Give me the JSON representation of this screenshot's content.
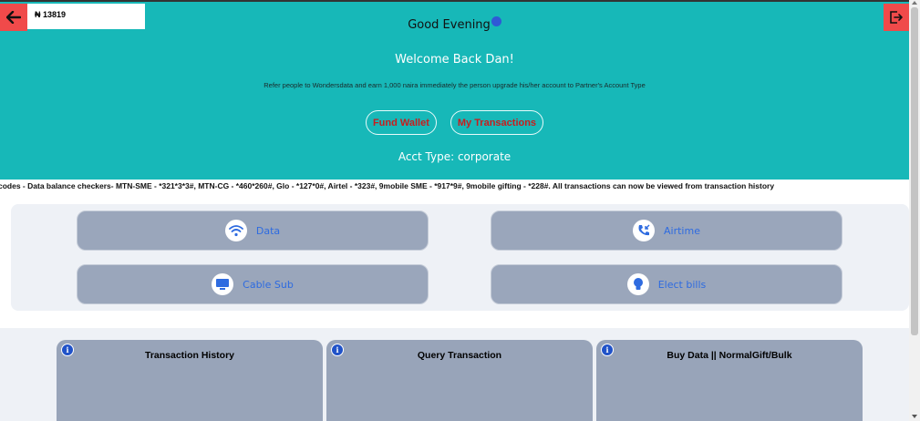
{
  "header": {
    "balance": "₦ 13819",
    "greeting": "Good Evening",
    "welcome": "Welcome Back Dan!",
    "refer_text": "Refer people to Wondersdata and earn 1,000 naira immediately the person upgrade his/her account to Partner's Account Type",
    "fund_wallet_label": "Fund Wallet",
    "my_transactions_label": "My Transactions",
    "account_type": "Acct Type: corporate"
  },
  "marquee": {
    "text": "codes - Data balance checkers- MTN-SME - *321*3*3#, MTN-CG - *460*260#, Glo - *127*0#, Airtel - *323#, 9mobile SME - *917*9#, 9mobile gifting - *228#. All transactions can now be viewed from transaction history"
  },
  "services": [
    {
      "label": "Data",
      "icon": "wifi-icon"
    },
    {
      "label": "Airtime",
      "icon": "phone-incoming-icon"
    },
    {
      "label": "Cable Sub",
      "icon": "monitor-icon"
    },
    {
      "label": "Elect bills",
      "icon": "lightbulb-icon"
    }
  ],
  "cards": [
    {
      "title": "Transaction History",
      "info_glyph": "i"
    },
    {
      "title": "Query Transaction",
      "info_glyph": "i"
    },
    {
      "title": "Buy Data || NormalGift/Bulk",
      "info_glyph": "i"
    }
  ],
  "colors": {
    "hero_bg": "#17b8b8",
    "accent_red": "#f04a4a",
    "button_text_red": "#c81d1d",
    "service_text_blue": "#2e6be0",
    "card_bg": "#98a4b9"
  }
}
